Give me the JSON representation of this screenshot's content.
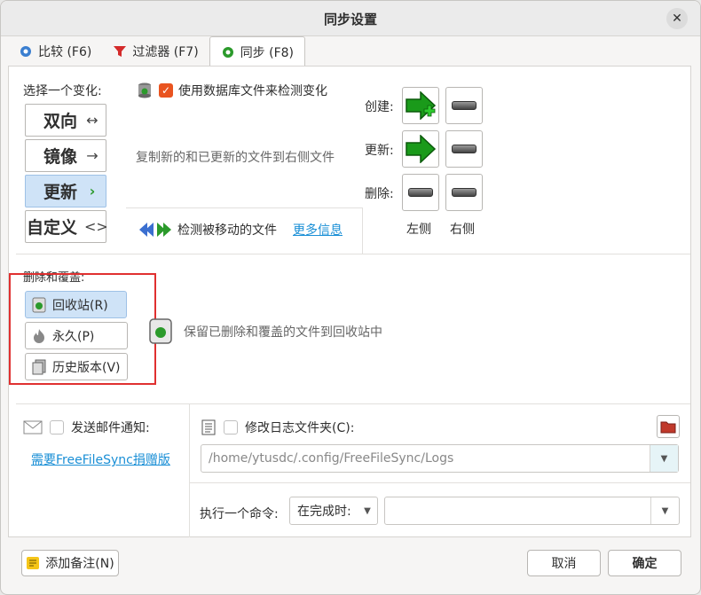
{
  "window": {
    "title": "同步设置"
  },
  "tabs": [
    {
      "label": "比较 (F6)",
      "icon": "gear-blue-icon"
    },
    {
      "label": "过滤器 (F7)",
      "icon": "funnel-icon"
    },
    {
      "label": "同步 (F8)",
      "icon": "gear-green-icon"
    }
  ],
  "variant": {
    "label": "选择一个变化:",
    "options": [
      {
        "label": "双向",
        "arrow": "↔"
      },
      {
        "label": "镜像",
        "arrow": "→"
      },
      {
        "label": "更新",
        "arrow": "›"
      },
      {
        "label": "自定义",
        "arrow": "<>"
      }
    ],
    "selected": "更新",
    "use_db_label": "使用数据库文件来检测变化",
    "description": "复制新的和已更新的文件到右侧文件",
    "detect_moved_label": "检测被移动的文件",
    "more_info": "更多信息"
  },
  "actions": {
    "create_label": "创建:",
    "update_label": "更新:",
    "delete_label": "删除:",
    "left_label": "左侧",
    "right_label": "右侧"
  },
  "deletion": {
    "label": "删除和覆盖:",
    "options": [
      {
        "label": "回收站(R)"
      },
      {
        "label": "永久(P)"
      },
      {
        "label": "历史版本(V)"
      }
    ],
    "description": "保留已删除和覆盖的文件到回收站中"
  },
  "email": {
    "label": "发送邮件通知:",
    "donation_link": "需要FreeFileSync捐赠版"
  },
  "log": {
    "label": "修改日志文件夹(C):",
    "path": "/home/ytusdc/.config/FreeFileSync/Logs"
  },
  "command": {
    "label": "执行一个命令:",
    "when": "在完成时:",
    "value": ""
  },
  "footer": {
    "add_note": "添加备注(N)",
    "cancel": "取消",
    "ok": "确定"
  },
  "colors": {
    "accent": "#e95420",
    "selected": "#cfe3f7",
    "link": "#1a8fd6",
    "highlight_box": "#e03030"
  }
}
